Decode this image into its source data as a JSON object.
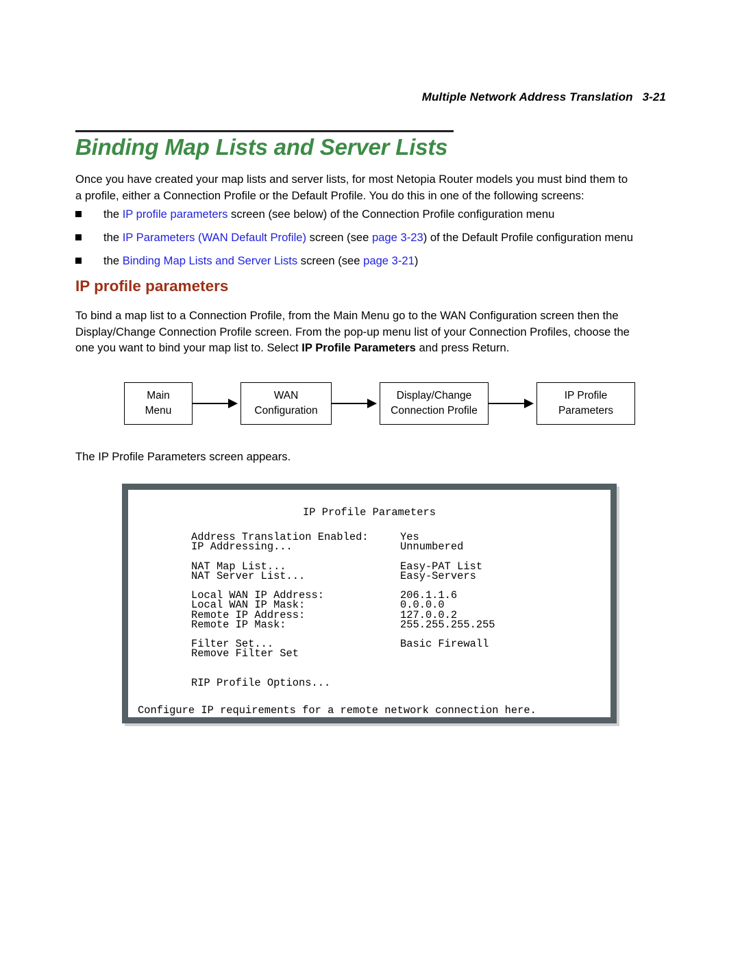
{
  "header": {
    "running_title": "Multiple Network Address Translation",
    "page_number": "3-21"
  },
  "title": "Binding Map Lists and Server Lists",
  "intro_paragraph": {
    "line1": "Once you have created your map lists and server lists, for most Netopia Router models you must bind them to",
    "line2": "a profile, either a Connection Profile or the Default Profile. You do this in one of the following screens:"
  },
  "bullets": [
    {
      "pre": "the ",
      "link": "IP profile parameters",
      "post": " screen (see below) of the Connection Profile configuration menu"
    },
    {
      "pre": "the ",
      "link": "IP Parameters (WAN Default Profile)",
      "mid": " screen (see ",
      "link2": "page 3-23",
      "post": ") of the Default Profile configuration menu"
    },
    {
      "pre": "the ",
      "link": "Binding Map Lists and Server Lists",
      "mid": " screen (see ",
      "link2": "page 3-21",
      "post": ")"
    }
  ],
  "sub_heading": "IP profile parameters",
  "bind_paragraph": {
    "line1": "To bind a map list to a Connection Profile, from the Main Menu go to the WAN Configuration screen then the",
    "line2": "Display/Change Connection Profile screen. From the pop-up menu list of your Connection Profiles, choose the",
    "line3_pre": "one you want to bind your map list to. Select ",
    "line3_bold": "IP Profile Parameters",
    "line3_post": " and press Return."
  },
  "flow_diagram": {
    "boxes": [
      {
        "line1": "Main",
        "line2": "Menu"
      },
      {
        "line1": "WAN",
        "line2": "Configuration"
      },
      {
        "line1": "Display/Change",
        "line2": "Connection Profile"
      },
      {
        "line1": "IP Profile",
        "line2": "Parameters"
      }
    ]
  },
  "appears_text": "The IP Profile Parameters screen appears.",
  "terminal": {
    "title": "IP Profile Parameters",
    "rows": [
      {
        "label": "Address Translation Enabled:",
        "value": "Yes"
      },
      {
        "label": "IP Addressing...",
        "value": "Unnumbered"
      },
      {
        "gap": true
      },
      {
        "label": "NAT Map List...",
        "value": "Easy-PAT List"
      },
      {
        "label": "NAT Server List...",
        "value": "Easy-Servers"
      },
      {
        "gap": true
      },
      {
        "label": "Local WAN IP Address:",
        "value": "206.1.1.6"
      },
      {
        "label": "Local WAN IP Mask:",
        "value": "0.0.0.0"
      },
      {
        "label": "Remote IP Address:",
        "value": "127.0.0.2"
      },
      {
        "label": "Remote IP Mask:",
        "value": "255.255.255.255"
      },
      {
        "gap": true
      },
      {
        "label": "Filter Set...",
        "value": "Basic Firewall"
      },
      {
        "label": "Remove Filter Set",
        "value": ""
      },
      {
        "gap": true
      },
      {
        "gap": true
      },
      {
        "label": "RIP Profile Options...",
        "value": ""
      }
    ],
    "footer": "Configure IP requirements for a remote network connection here."
  },
  "colors": {
    "title_green": "#3d8b46",
    "subheading_red": "#9c3016",
    "link_blue": "#2222dd",
    "terminal_border": "#556065"
  }
}
